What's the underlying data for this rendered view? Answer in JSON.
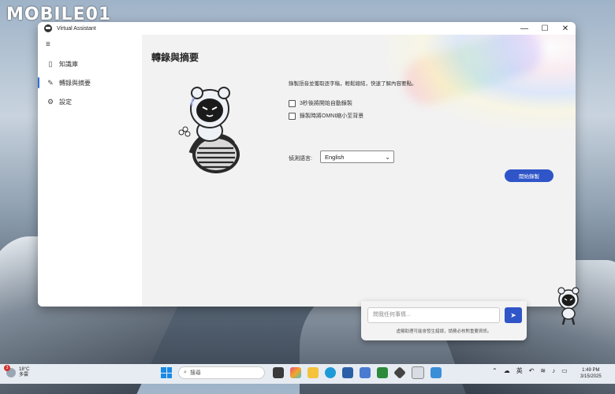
{
  "watermark": "MOBILE01",
  "window": {
    "title": "Virtual Assistant",
    "controls": {
      "minimize": "—",
      "maximize": "☐",
      "close": "✕"
    }
  },
  "sidebar": {
    "menu_icon": "≡",
    "items": [
      {
        "label": "知識庫",
        "icon": "book-icon",
        "glyph": "▯"
      },
      {
        "label": "轉錄與摘要",
        "icon": "edit-icon",
        "glyph": "✎"
      },
      {
        "label": "設定",
        "icon": "gear-icon",
        "glyph": "⚙"
      }
    ]
  },
  "main": {
    "title": "轉錄與摘要",
    "description": "錄製語音並獲取逐字稿，輕鬆總結，快速了解內容要點。",
    "options": [
      {
        "label": "3秒後將開始自動錄製",
        "checked": false
      },
      {
        "label": "錄製時將OMNI縮小至背景",
        "checked": false
      }
    ],
    "language_label": "偵測語言:",
    "language_value": "English",
    "record_button": "開始錄製"
  },
  "chat": {
    "placeholder": "問我任何事情...",
    "disclaimer": "虛擬助理可能會發生錯誤，請務必核對重要資訊。"
  },
  "taskbar": {
    "weather_badge": "3",
    "temperature": "18°C",
    "condition": "多雲",
    "search_placeholder": "搜尋",
    "ime": "英",
    "time": "1:49 PM",
    "date": "3/15/2025"
  },
  "colors": {
    "accent": "#2f55c8",
    "content_bg": "#f2f2f2"
  }
}
